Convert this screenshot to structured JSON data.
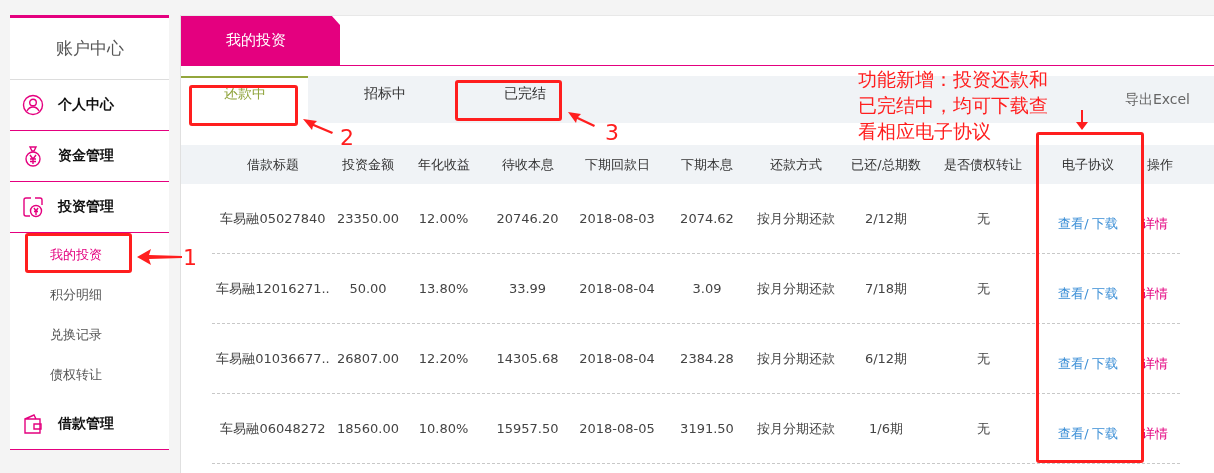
{
  "sidebar": {
    "title": "账户中心",
    "sections": [
      {
        "label": "个人中心"
      },
      {
        "label": "资金管理"
      },
      {
        "label": "投资管理",
        "children": [
          {
            "label": "我的投资",
            "selected": true
          },
          {
            "label": "积分明细",
            "selected": false
          },
          {
            "label": "兑换记录",
            "selected": false
          },
          {
            "label": "债权转让",
            "selected": false
          }
        ]
      },
      {
        "label": "借款管理"
      }
    ]
  },
  "main_tabs": [
    {
      "label": "我的投资",
      "selected": true
    }
  ],
  "sub_tabs": [
    {
      "label": "还款中",
      "selected": true
    },
    {
      "label": "招标中",
      "selected": false
    },
    {
      "label": "已完结",
      "selected": false
    }
  ],
  "export_link": "导出Excel",
  "table": {
    "columns": [
      "借款标题",
      "投资金额",
      "年化收益",
      "待收本息",
      "下期回款日",
      "下期本息",
      "还款方式",
      "已还/总期数",
      "是否债权转让",
      "电子协议",
      "操作"
    ],
    "rows": [
      {
        "cells": [
          "车易融05027840",
          "23350.00",
          "12.00%",
          "20746.20",
          "2018-08-03",
          "2074.62",
          "按月分期还款",
          "2/12期",
          "无"
        ],
        "view": "查看",
        "separator": "/",
        "download": "下载",
        "action": "详情"
      },
      {
        "cells": [
          "车易融12016271..",
          "50.00",
          "13.80%",
          "33.99",
          "2018-08-04",
          "3.09",
          "按月分期还款",
          "7/18期",
          "无"
        ],
        "view": "查看",
        "separator": "/",
        "download": "下载",
        "action": "详情"
      },
      {
        "cells": [
          "车易融01036677..",
          "26807.00",
          "12.20%",
          "14305.68",
          "2018-08-04",
          "2384.28",
          "按月分期还款",
          "6/12期",
          "无"
        ],
        "view": "查看",
        "separator": "/",
        "download": "下载",
        "action": "详情"
      },
      {
        "cells": [
          "车易融06048272",
          "18560.00",
          "10.80%",
          "15957.50",
          "2018-08-05",
          "3191.50",
          "按月分期还款",
          "1/6期",
          "无"
        ],
        "view": "查看",
        "separator": "/",
        "download": "下载",
        "action": "详情"
      }
    ]
  },
  "annotations": {
    "callouts": [
      "1",
      "2",
      "3"
    ],
    "note": "功能新增：投资还款和已完结中，均可下载查看相应电子协议"
  }
}
